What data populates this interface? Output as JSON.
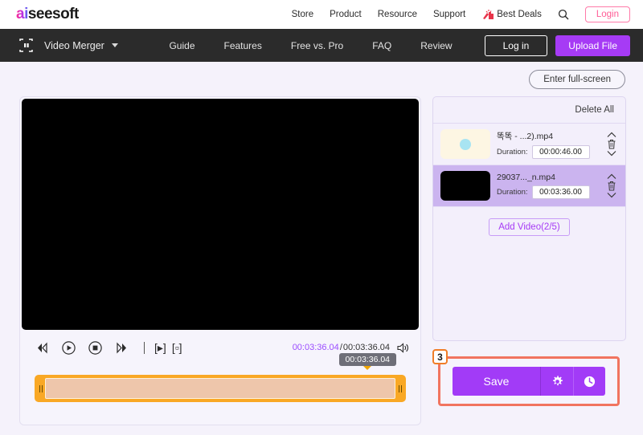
{
  "brand": {
    "logo_ai": "ai",
    "logo_rest": "seesoft"
  },
  "topnav": {
    "links": [
      "Store",
      "Product",
      "Resource",
      "Support"
    ],
    "deals_label": "Best Deals",
    "deals_icon": "firecracker-icon",
    "search_icon": "search-icon",
    "login_label": "Login"
  },
  "darknav": {
    "app_icon": "merge-frames-icon",
    "app_title": "Video Merger",
    "caret_icon": "chevron-down-icon",
    "links": [
      "Guide",
      "Features",
      "Free vs. Pro",
      "FAQ",
      "Review"
    ],
    "login_label": "Log in",
    "upload_label": "Upload File"
  },
  "toolbar": {
    "fullscreen_label": "Enter full-screen"
  },
  "player": {
    "controls": [
      {
        "name": "rewind-icon",
        "label": "rewind"
      },
      {
        "name": "play-icon",
        "label": "play"
      },
      {
        "name": "stop-icon",
        "label": "stop"
      },
      {
        "name": "fast-forward-icon",
        "label": "fast-forward"
      }
    ],
    "bracket_play": "[▸]",
    "bracket_stop": "[▫]",
    "current_time": "00:03:36.04",
    "time_separator": "/",
    "total_time": "00:03:36.04",
    "volume_icon": "speaker-icon",
    "timeline_tooltip": "00:03:36.04"
  },
  "filelist": {
    "delete_all_label": "Delete All",
    "duration_label": "Duration:",
    "items": [
      {
        "name": "똑똑 - ...2).mp4",
        "duration": "00:00:46.00",
        "thumb": "cream",
        "selected": false
      },
      {
        "name": "29037..._n.mp4",
        "duration": "00:03:36.00",
        "thumb": "black",
        "selected": true
      }
    ],
    "add_video_label": "Add Video(2/5)"
  },
  "save": {
    "step_badge": "3",
    "save_label": "Save",
    "settings_icon": "gear-icon",
    "history_icon": "clock-icon"
  },
  "colors": {
    "accent_purple": "#a23bf7",
    "highlight_orange": "#f07d27",
    "highlight_red": "#f1745f",
    "timeline_orange": "#f9a825",
    "page_bg": "#f5f2fb",
    "login_pink": "#ff5c95"
  }
}
